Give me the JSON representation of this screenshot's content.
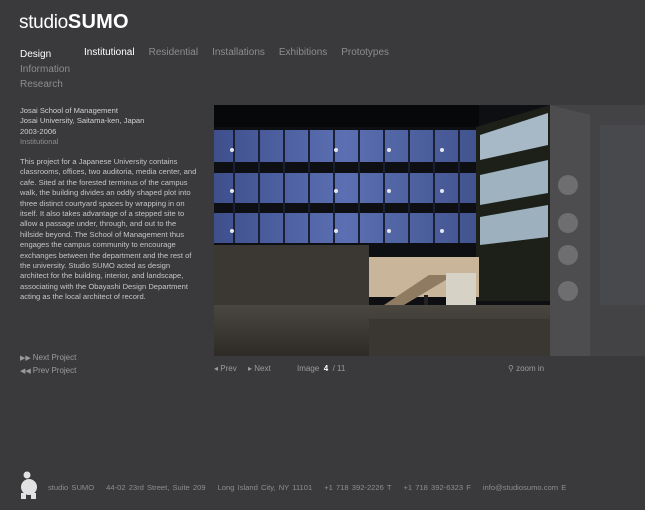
{
  "brand": {
    "name_light": "studio",
    "name_bold": "SUMO"
  },
  "nav": {
    "primary": [
      {
        "label": "Design",
        "active": true
      },
      {
        "label": "Information",
        "active": false
      },
      {
        "label": "Research",
        "active": false
      }
    ],
    "secondary": [
      {
        "label": "Institutional",
        "active": true
      },
      {
        "label": "Residential",
        "active": false
      },
      {
        "label": "Installations",
        "active": false
      },
      {
        "label": "Exhibitions",
        "active": false
      },
      {
        "label": "Prototypes",
        "active": false
      }
    ]
  },
  "project": {
    "title": "Josai School of Management",
    "location": "Josai University, Saitama-ken, Japan",
    "years": "2003-2006",
    "category": "Institutional",
    "description": "This project for a Japanese University contains classrooms, offices, two auditoria, media center, and cafe. Sited at the forested terminus of the campus walk, the building divides an oddly shaped plot into three distinct courtyard spaces by wrapping in on itself. It also takes advantage of a stepped site to allow a passage under, through, and out to the hillside beyond. The School of Management thus engages the campus community to encourage exchanges between the department and the rest of the university.  Studio SUMO acted as design architect for the building, interior, and landscape, associating with the Obayashi Design Department acting as the local architect of record."
  },
  "project_nav": {
    "next": "Next Project",
    "prev": "Prev Project"
  },
  "image_nav": {
    "prev": "Prev",
    "next": "Next",
    "image_label": "Image",
    "current": "4",
    "total": "/ 11",
    "zoom": "zoom in"
  },
  "footer": {
    "company": "studio SUMO",
    "address": "44-02 23rd Street, Suite 209",
    "city": "Long Island City, NY 11101",
    "phone": "+1 718 392-2226  T",
    "fax": "+1 718 392-6323  F",
    "email": "info@studiosumo.com  E"
  },
  "icons": {
    "next_project": "double-chevron-right-icon",
    "prev_project": "double-chevron-left-icon",
    "prev_image": "triangle-left-icon",
    "next_image": "triangle-right-icon",
    "zoom": "magnifier-icon",
    "footer_logo": "sumo-wrestler-icon"
  }
}
